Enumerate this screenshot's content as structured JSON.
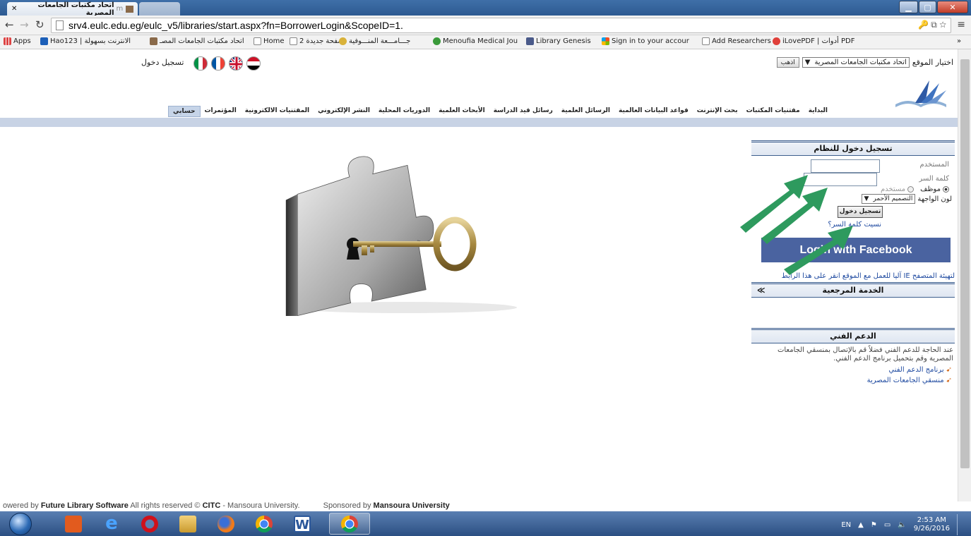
{
  "browser": {
    "tab_active_title": "اتحاد مكتبات الجامعات المصرية",
    "tab_active_suffix": "m",
    "url": "srv4.eulc.edu.eg/eulc_v5/libraries/start.aspx?fn=BorrowerLogin&ScopeID=1.",
    "bookmarks": [
      {
        "label": "Apps"
      },
      {
        "label": "Hao123 | الانترنت بسهولة"
      },
      {
        "label": "اتحاد مكتبات الجامعات المصـ"
      },
      {
        "label": "Home"
      },
      {
        "label": "صفحة جديدة 2"
      },
      {
        "label": "جـــامـــعة المنـــوفية"
      },
      {
        "label": "Menoufia Medical Jou"
      },
      {
        "label": "Library Genesis"
      },
      {
        "label": "Sign in to your accour"
      },
      {
        "label": "Add Researchers"
      },
      {
        "label": "iLovePDF | أدوات PDF"
      }
    ],
    "more": "»"
  },
  "header": {
    "login_link": "تسجيل دخول",
    "site_select_label": "اختيار الموقع",
    "site_select_value": "اتحاد مكتبات الجامعات المصرية",
    "go_button": "اذهب",
    "flags": [
      "egypt-flag",
      "uk-flag",
      "france-flag",
      "italy-flag"
    ]
  },
  "menu": [
    "البداية",
    "مقتنيات المكتبات",
    "بحث الإنترنت",
    "قواعد البيانات العالمية",
    "الرسائل العلمية",
    "رسائل قيد الدراسة",
    "الأبحاث العلمية",
    "الدوريات المحلية",
    "النشر الإلكتروني",
    "المقتنيات الالكترونية",
    "المؤتمرات",
    "حسابي"
  ],
  "login_panel": {
    "title": "تسجيل دخول للنظام",
    "username_label": "المستخدم",
    "password_label": "كلمة السر",
    "username_value": "",
    "password_value": "",
    "radio_employee": "موظف",
    "radio_user": "مستخدم",
    "theme_label": "لون الواجهة",
    "theme_value": "التصميم الأحمر",
    "login_button": "تسجيل دخول",
    "forgot_link": "نسيت كلمة السر؟",
    "facebook_button": "Login with Facebook",
    "ie_setup_link": "لتهيئة المتصفح IE آليا للعمل مع الموقع انقر على هذا الرابط"
  },
  "reference_panel": {
    "title": "الخدمة المرجعية"
  },
  "support_panel": {
    "title": "الدعم الفني",
    "text": "عند الحاجة للدعم الفني فضلاً قم بالإتصال بمنسقي الجامعات المصرية وقم بتحميل برنامج الدعم الفني.",
    "links": [
      "برنامج الدعم الفني",
      "منسقي الجامعات المصرية"
    ]
  },
  "footer": {
    "powered_prefix": "owered by ",
    "powered_brand": "Future Library Software",
    "rights": " All rights reserved © ",
    "citc": "CITC",
    "university": " - Mansoura University.",
    "sponsored_prefix": "Sponsored by ",
    "sponsor": "Mansoura University"
  },
  "taskbar": {
    "lang": "EN",
    "time": "2:53 AM",
    "date": "9/26/2016"
  },
  "colors": {
    "menu_strip": "#c8d3e5",
    "panel_border": "#3e5f8e",
    "facebook": "#4a63a0",
    "arrow": "#2e9a5e"
  }
}
